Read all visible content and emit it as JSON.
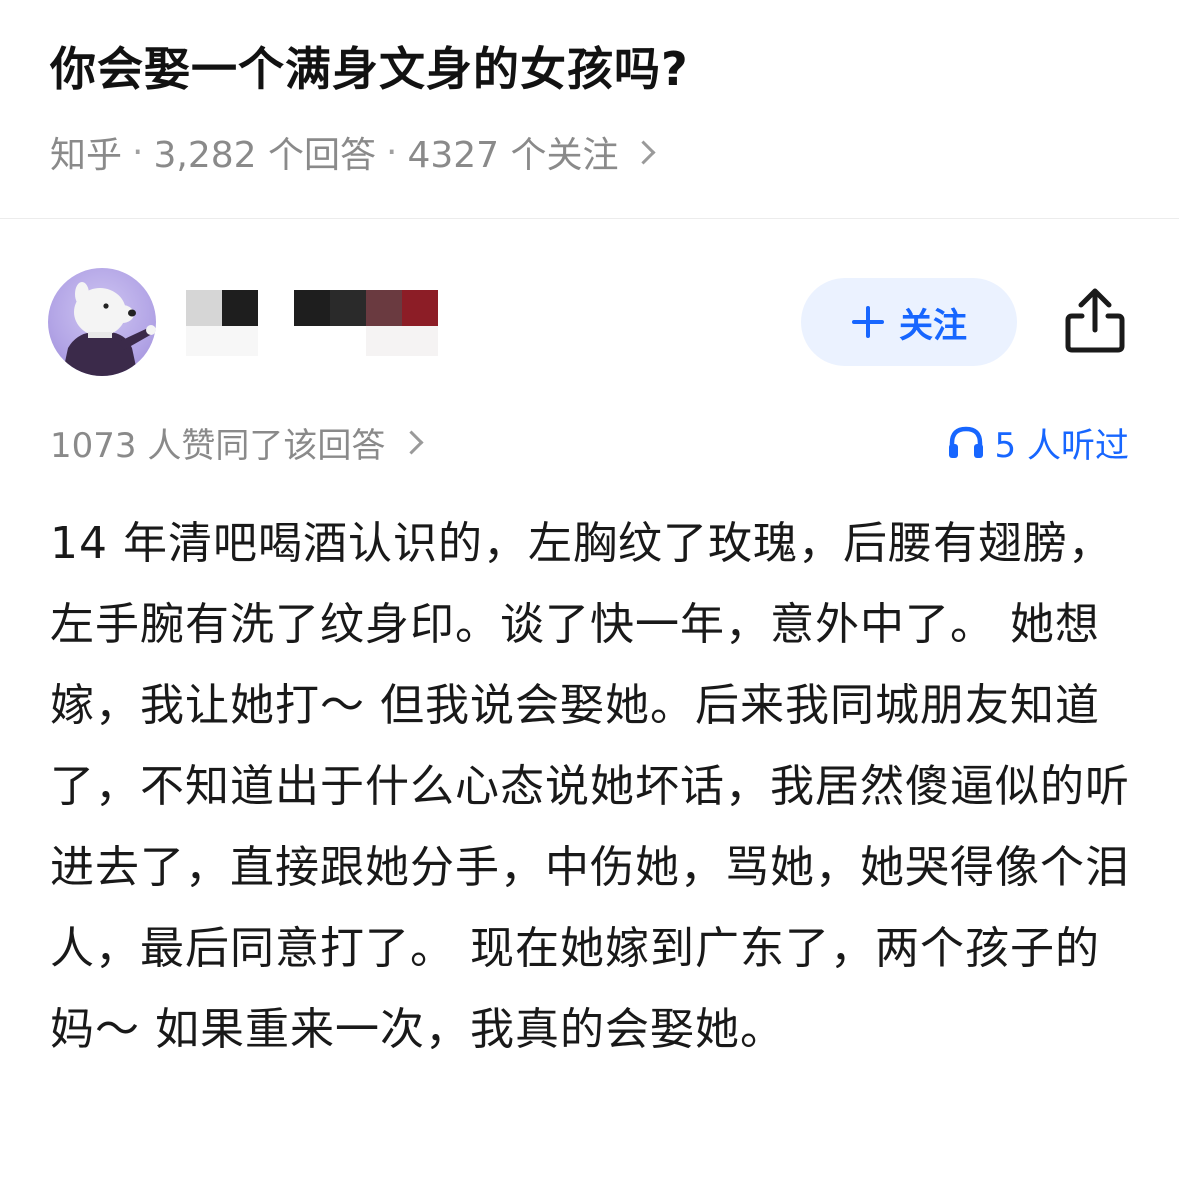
{
  "question": {
    "title": "你会娶一个满身文身的女孩吗?",
    "source": "知乎",
    "sep": "·",
    "answers_count": "3,282 个回答",
    "followers_count": "4327 个关注"
  },
  "author": {
    "name_censored": true,
    "follow_button_label": "关注",
    "follow_icon": "plus-icon",
    "share_icon": "share-icon"
  },
  "answer": {
    "upvotes_text": "1073 人赞同了该回答",
    "listen_icon": "headphones-icon",
    "listen_text": "5 人听过",
    "content": "14 年清吧喝酒认识的，左胸纹了玫瑰，后腰有翅膀，左手腕有洗了纹身印。谈了快一年，意外中了。 她想嫁，我让她打～ 但我说会娶她。后来我同城朋友知道了，不知道出于什么心态说她坏话，我居然傻逼似的听进去了，直接跟她分手，中伤她，骂她，她哭得像个泪人，最后同意打了。 现在她嫁到广东了，两个孩子的妈～ 如果重来一次，我真的会娶她。"
  },
  "colors": {
    "accent": "#1766ff",
    "follow_bg": "#ebf2ff",
    "meta_text": "#8a8a8a"
  }
}
